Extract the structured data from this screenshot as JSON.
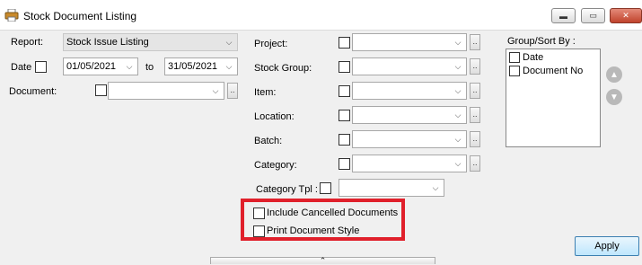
{
  "window": {
    "title": "Stock Document Listing",
    "minimize_glyph": "▬",
    "maximize_glyph": "▭",
    "close_glyph": "✕"
  },
  "form": {
    "report_label": "Report:",
    "report_value": "Stock Issue Listing",
    "date_label": "Date",
    "date_from": "01/05/2021",
    "to_label": "to",
    "date_to": "31/05/2021",
    "document_label": "Document:",
    "project_label": "Project:",
    "stock_group_label": "Stock Group:",
    "item_label": "Item:",
    "location_label": "Location:",
    "batch_label": "Batch:",
    "category_label": "Category:",
    "category_tpl_label": "Category Tpl :",
    "include_cancelled_label": "Include Cancelled Documents",
    "print_document_style_label": "Print Document Style",
    "dots_label": "..",
    "dropdown_glyph": "⌵"
  },
  "group_sort": {
    "title": "Group/Sort By :",
    "items": [
      {
        "label": "Date"
      },
      {
        "label": "Document No"
      }
    ],
    "up_glyph": "▲",
    "down_glyph": "▼"
  },
  "actions": {
    "apply_label": "Apply",
    "splitter_glyph": "⌃"
  },
  "colors": {
    "highlight": "#e0202b",
    "apply_border": "#3c7fb1"
  }
}
